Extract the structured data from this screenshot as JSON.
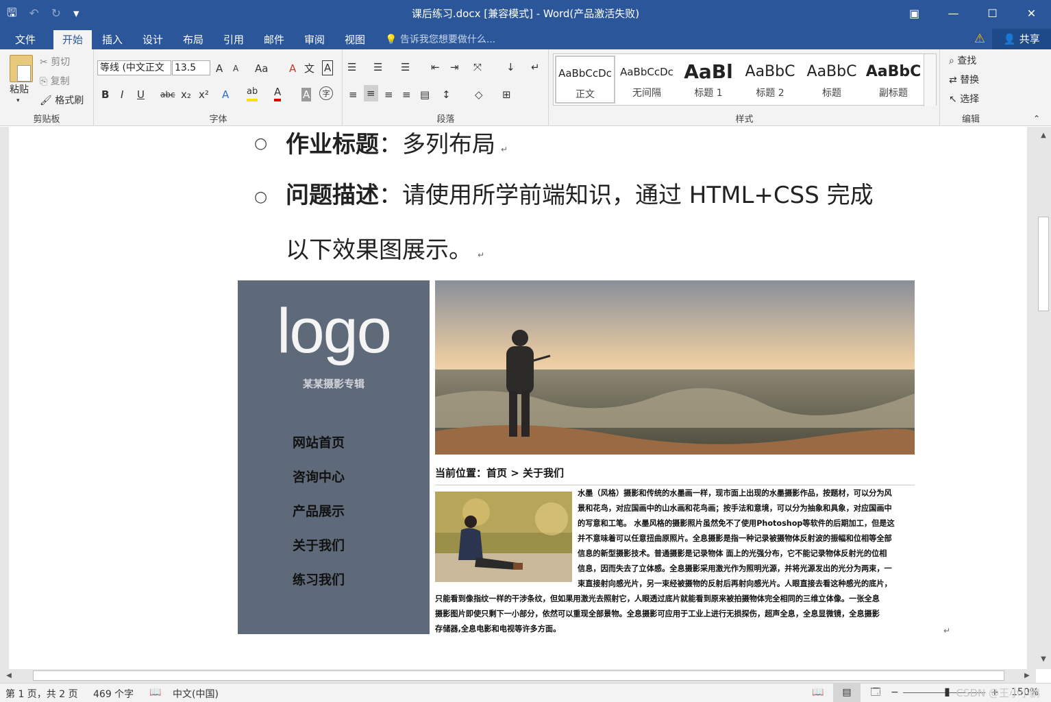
{
  "window": {
    "title": "课后练习.docx [兼容模式] - Word(产品激活失败)",
    "qat": {
      "save": "🖫",
      "undo": "↶",
      "redo": "↻",
      "customize": "▾"
    },
    "controls": {
      "restore_ribbon": "▣",
      "minimize": "—",
      "maximize": "☐",
      "close": "✕"
    }
  },
  "tabs": {
    "file": "文件",
    "home": "开始",
    "insert": "插入",
    "design": "设计",
    "layout": "布局",
    "references": "引用",
    "mailings": "邮件",
    "review": "审阅",
    "view": "视图",
    "tell_me": "告诉我您想要做什么...",
    "share": "共享",
    "active": "开始"
  },
  "ribbon": {
    "clipboard": {
      "label": "剪贴板",
      "paste": "粘贴",
      "cut": "剪切",
      "copy": "复制",
      "format_painter": "格式刷"
    },
    "font": {
      "label": "字体",
      "font_name": "等线 (中文正文",
      "font_size": "13.5",
      "grow": "A",
      "shrink": "A",
      "change_case": "Aa",
      "clear": "A",
      "phonetic": "文",
      "border_char": "A",
      "bold": "B",
      "italic": "I",
      "underline": "U",
      "strike": "abc",
      "subscript": "x₂",
      "superscript": "x²",
      "effects": "A",
      "highlight": "ab",
      "font_color": "A",
      "shading": "A",
      "enclose": "字"
    },
    "paragraph": {
      "label": "段落"
    },
    "styles": {
      "label": "样式",
      "items": [
        {
          "sample": "AaBbCcDc",
          "name": "正文"
        },
        {
          "sample": "AaBbCcDc",
          "name": "无间隔"
        },
        {
          "sample": "AaBl",
          "name": "标题 1"
        },
        {
          "sample": "AaBbC",
          "name": "标题 2"
        },
        {
          "sample": "AaBbC",
          "name": "标题"
        },
        {
          "sample": "AaBbC",
          "name": "副标题"
        }
      ]
    },
    "editing": {
      "label": "编辑",
      "find": "查找",
      "replace": "替换",
      "select": "选择"
    }
  },
  "document": {
    "bullets": [
      {
        "bold": "作业标题",
        "rest": "：多列布局"
      },
      {
        "bold": "问题描述",
        "rest": "：请使用所学前端知识，通过 HTML+CSS 完成"
      },
      {
        "bold": "",
        "rest": "以下效果图展示。"
      }
    ],
    "figure": {
      "logo": "logo",
      "subtitle": "某某摄影专辑",
      "nav": [
        "网站首页",
        "咨询中心",
        "产品展示",
        "关于我们",
        "练习我们"
      ],
      "breadcrumb": "当前位置：首页 > 关于我们",
      "text_lines_right": [
        "水墨（风格）摄影和传统的水墨画一样，现市面上出现的水墨摄影作品，按题材，可以分为风",
        "景和花鸟，对应国画中的山水画和花鸟画；按手法和意境，可以分为抽象和具象，对应国画中",
        "的写意和工笔。 水墨风格的摄影照片虽然免不了使用Photoshop等软件的后期加工，但是这",
        "并不意味着可以任意扭曲原照片。全息摄影是指一种记录被摄物体反射波的振幅和位相等全部",
        "信息的新型摄影技术。普通摄影是记录物体 面上的光强分布，它不能记录物体反射光的位相",
        "信息，因而失去了立体感。全息摄影采用激光作为照明光源，并将光源发出的光分为两束，一",
        "束直接射向感光片，另一束经被摄物的反射后再射向感光片。人眼直接去看这种感光的底片，"
      ],
      "text_lines_full": [
        "只能看到像指纹一样的干涉条纹，但如果用激光去照射它，人眼透过底片就能看到原来被拍摄物体完全相同的三维立体像。一张全息",
        "摄影图片即使只剩下一小部分，依然可以重现全部景物。全息摄影可应用于工业上进行无损探伤，超声全息，全息显微镜，全息摄影",
        "存储器,全息电影和电视等许多方面。"
      ]
    }
  },
  "statusbar": {
    "page": "第 1 页，共 2 页",
    "words": "469 个字",
    "language": "中文(中国)",
    "zoom": "150%"
  },
  "watermark": "CSDN @王小小鹏",
  "colors": {
    "accent": "#2b579a",
    "sidebar": "#5e6a79"
  }
}
